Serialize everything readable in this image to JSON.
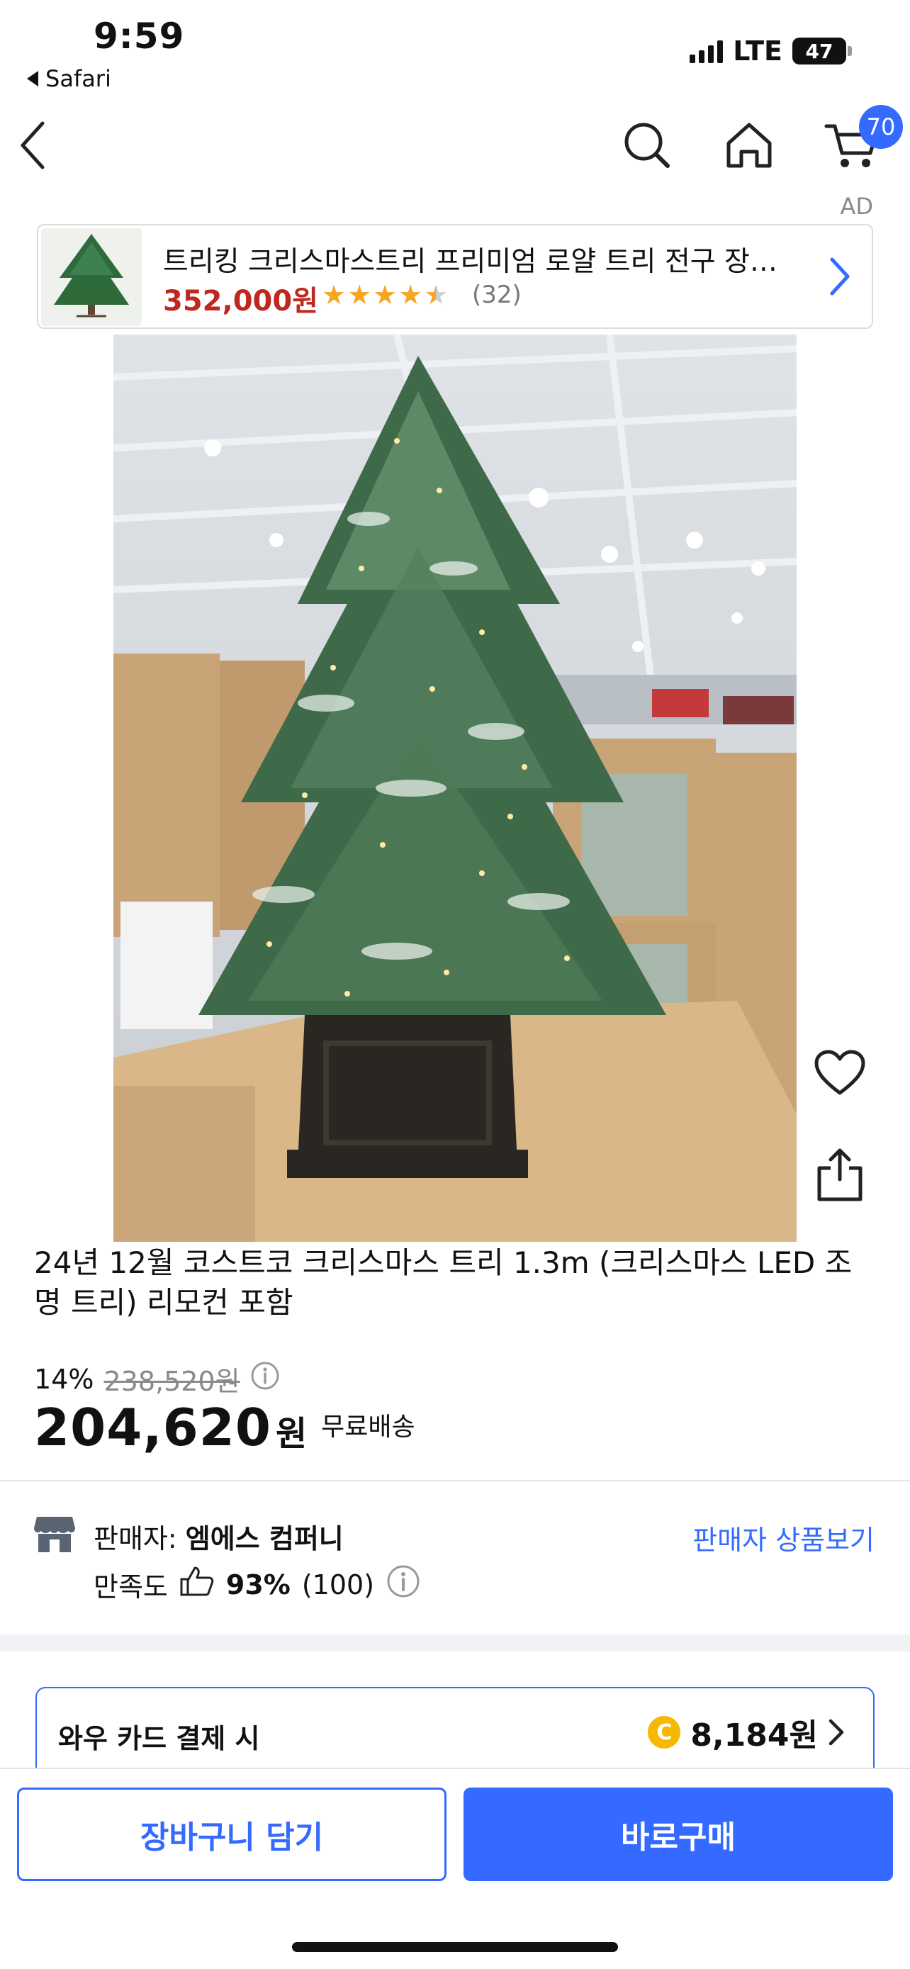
{
  "status_bar": {
    "time": "9:59",
    "back_app": "Safari",
    "network": "LTE",
    "battery": "47"
  },
  "header": {
    "cart_count": "70"
  },
  "ad": {
    "label": "AD",
    "title": "트리킹 크리스마스트리 프리미엄 로얄 트리 전구 장식...",
    "price": "352,000원",
    "rating": 4.5,
    "review_count": "(32)"
  },
  "product": {
    "title": "24년 12월 코스트코 크리스마스 트리 1.3m (크리스마스 LED 조명 트리) 리모컨 포함",
    "discount_rate": "14%",
    "original_price": "238,520원",
    "price": "204,620",
    "price_unit": "원",
    "shipping": "무료배송"
  },
  "seller": {
    "label": "판매자: ",
    "name": "엠에스 컴퍼니",
    "link": "판매자 상품보기",
    "satisfaction_label": "만족도",
    "satisfaction_pct": "93%",
    "satisfaction_count": "(100)"
  },
  "wow_card": {
    "label": "와우 카드 결제 시",
    "coin_symbol": "C",
    "amount": "8,184원"
  },
  "bottom": {
    "cart_button": "장바구니 담기",
    "buy_button": "바로구매"
  },
  "colors": {
    "accent": "#346aff",
    "ad_price": "#c0271e",
    "star": "#f5a623"
  }
}
